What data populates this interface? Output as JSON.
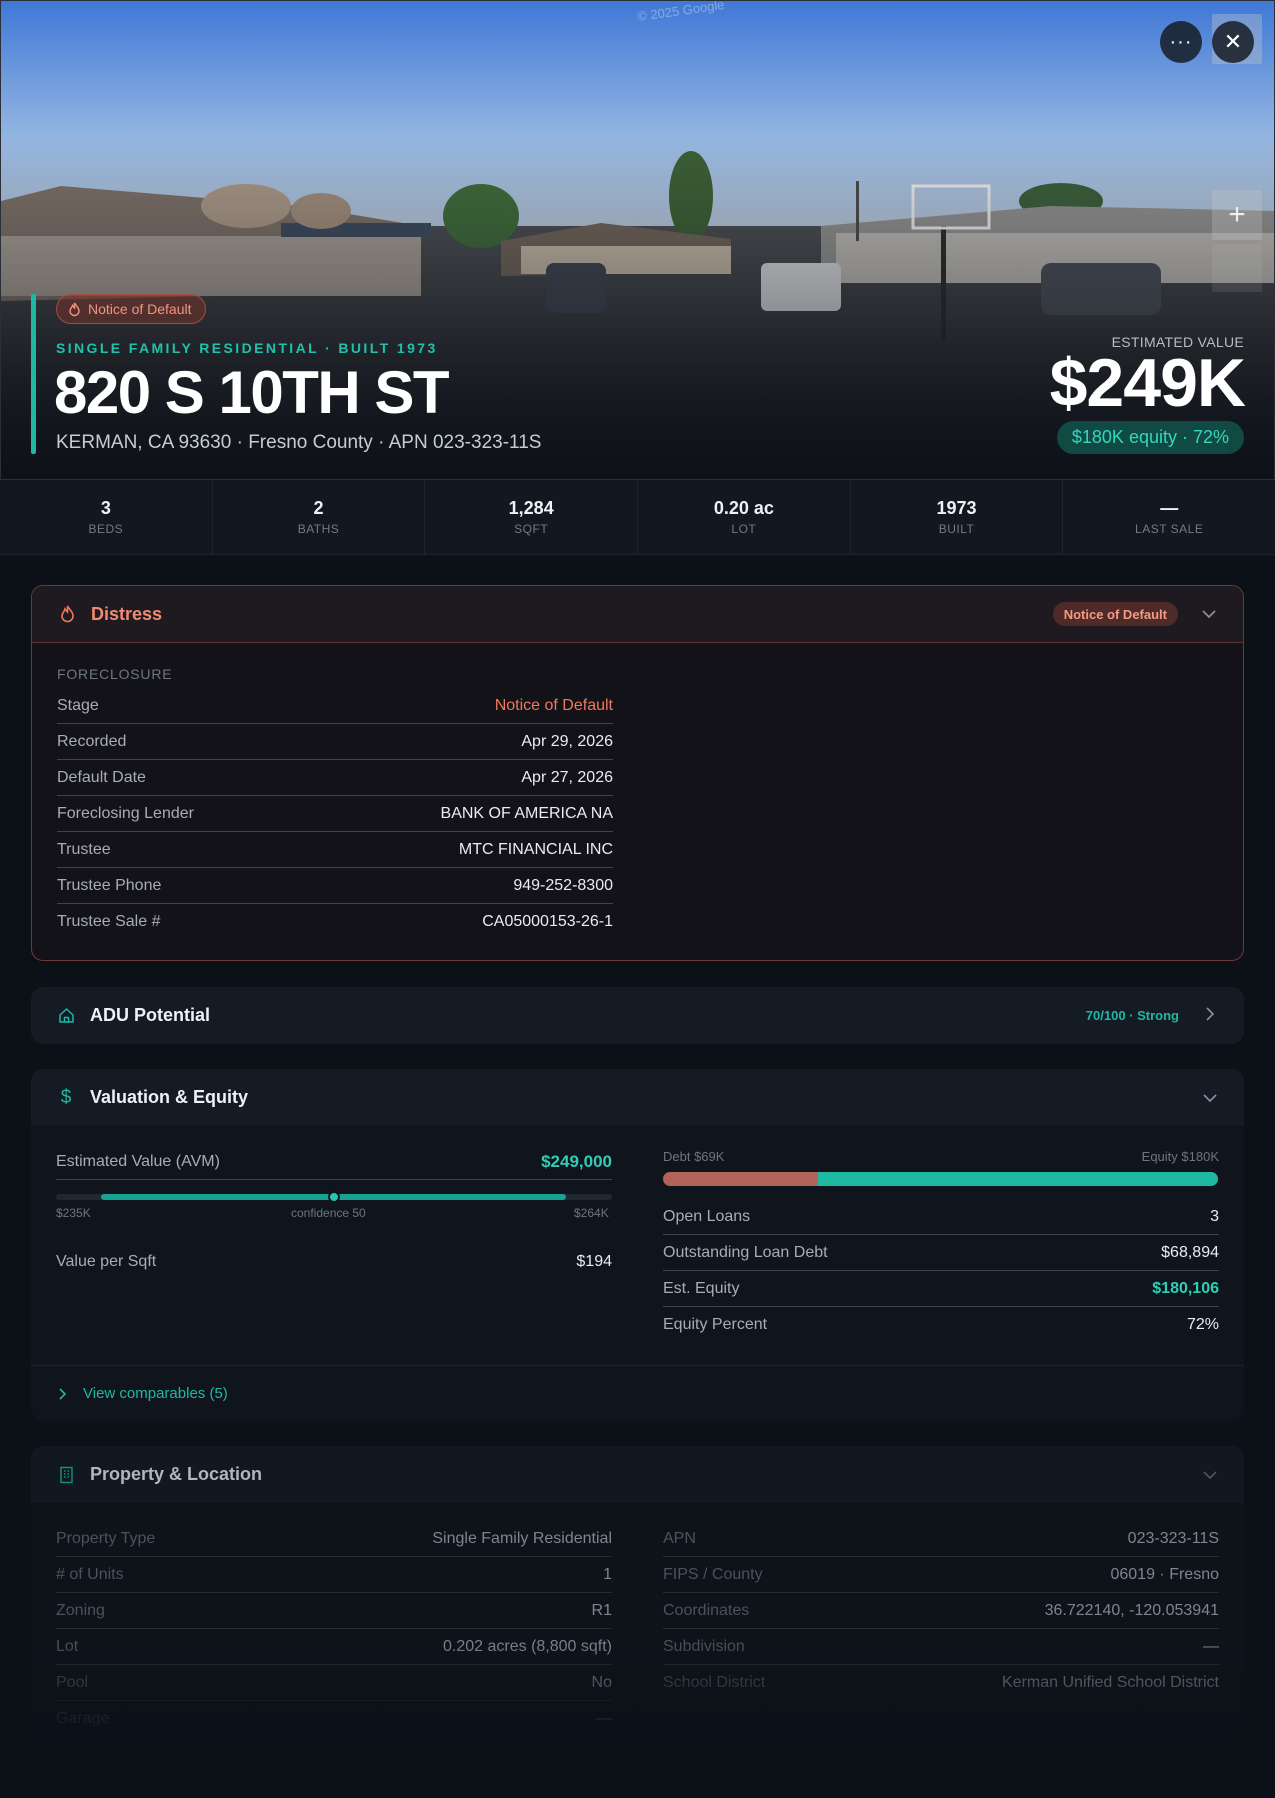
{
  "hero": {
    "watermark": "© 2025 Google",
    "more_label": "···",
    "close_label": "✕",
    "zoom_label": "+",
    "distress_pill": "Notice of Default",
    "property_type": "SINGLE FAMILY RESIDENTIAL · BUILT 1973",
    "address": "820 S 10TH ST",
    "subaddress": "KERMAN, CA 93630 · Fresno County · APN 023-323-11S",
    "estimated_label": "ESTIMATED VALUE",
    "estimated_value": "$249K",
    "equity_pill": "$180K equity · 72%"
  },
  "stats": [
    {
      "value": "3",
      "label": "BEDS"
    },
    {
      "value": "2",
      "label": "BATHS"
    },
    {
      "value": "1,284",
      "label": "SQFT"
    },
    {
      "value": "0.20 ac",
      "label": "LOT"
    },
    {
      "value": "1973",
      "label": "BUILT"
    },
    {
      "value": "—",
      "label": "LAST SALE"
    }
  ],
  "distress": {
    "title": "Distress",
    "badge": "Notice of Default",
    "section_label": "FORECLOSURE",
    "rows": [
      {
        "k": "Stage",
        "v": "Notice of Default"
      },
      {
        "k": "Recorded",
        "v": "Apr 29, 2026"
      },
      {
        "k": "Default Date",
        "v": "Apr 27, 2026"
      },
      {
        "k": "Foreclosing Lender",
        "v": "BANK OF AMERICA NA"
      },
      {
        "k": "Trustee",
        "v": "MTC FINANCIAL INC"
      },
      {
        "k": "Trustee Phone",
        "v": "949-252-8300"
      },
      {
        "k": "Trustee Sale #",
        "v": "CA05000153-26-1"
      }
    ]
  },
  "adu": {
    "title": "ADU Potential",
    "score": "70/100 · Strong"
  },
  "valuation": {
    "title": "Valuation & Equity",
    "avm_label": "Estimated Value (AVM)",
    "avm_value": "$249,000",
    "range_low": "$235K",
    "range_high": "$264K",
    "confidence": "confidence 50",
    "value_per_sqft_label": "Value per Sqft",
    "value_per_sqft": "$194",
    "debt_label": "Debt $69K",
    "equity_label": "Equity $180K",
    "equity_fraction": 0.72,
    "rows": [
      {
        "k": "Open Loans",
        "v": "3"
      },
      {
        "k": "Outstanding Loan Debt",
        "v": "$68,894"
      },
      {
        "k": "Est. Equity",
        "v": "$180,106"
      },
      {
        "k": "Equity Percent",
        "v": "72%"
      }
    ],
    "comps_link": "View comparables (5)"
  },
  "property": {
    "title": "Property & Location",
    "left": [
      {
        "k": "Property Type",
        "v": "Single Family Residential"
      },
      {
        "k": "# of Units",
        "v": "1"
      },
      {
        "k": "Zoning",
        "v": "R1"
      },
      {
        "k": "Lot",
        "v": "0.202 acres (8,800 sqft)"
      },
      {
        "k": "Pool",
        "v": "No"
      },
      {
        "k": "Garage",
        "v": "—"
      }
    ],
    "right": [
      {
        "k": "APN",
        "v": "023-323-11S"
      },
      {
        "k": "FIPS / County",
        "v": "06019 · Fresno"
      },
      {
        "k": "Coordinates",
        "v": "36.722140, -120.053941"
      },
      {
        "k": "Subdivision",
        "v": "—"
      },
      {
        "k": "School District",
        "v": "Kerman Unified School District"
      }
    ]
  },
  "colors": {
    "accent": "#1fb8a3",
    "distress": "#f08a72",
    "debt": "#b3625a",
    "background": "#0c1017"
  }
}
